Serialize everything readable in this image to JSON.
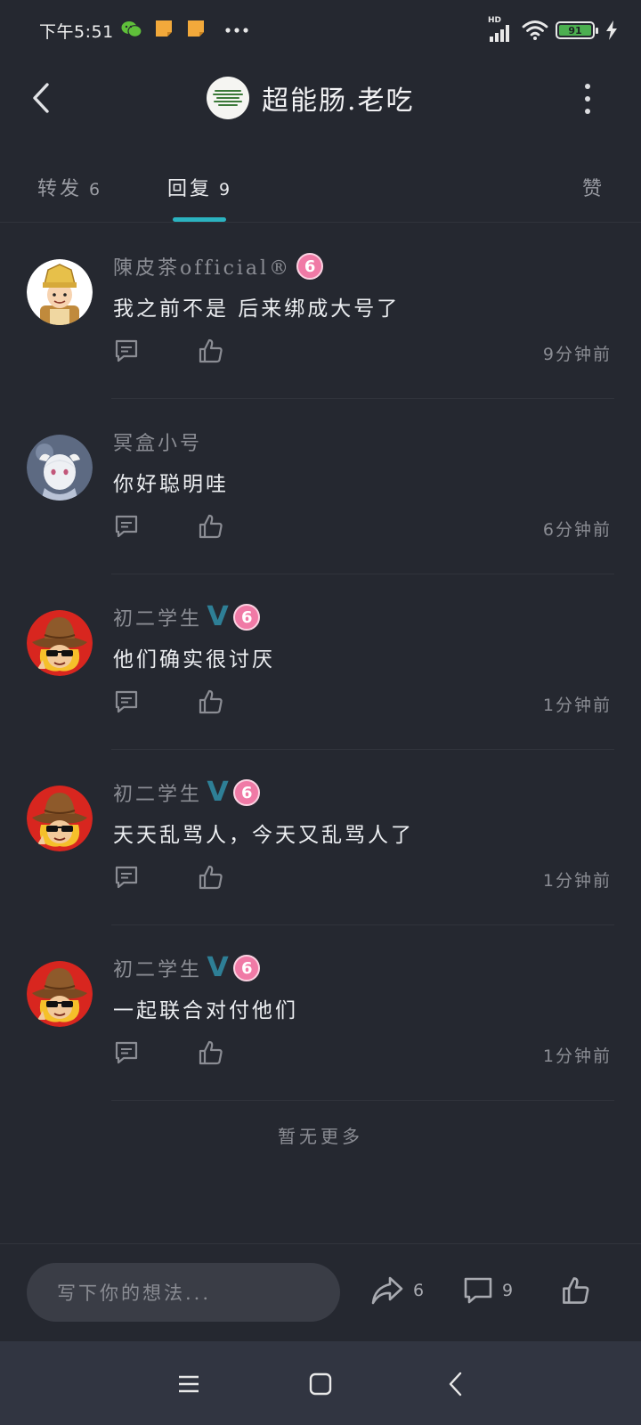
{
  "status_bar": {
    "time": "下午5:51",
    "network_label": "HD",
    "battery_level": "91",
    "icons": [
      "wechat-icon",
      "note-icon",
      "note-icon",
      "more-dots-icon",
      "signal-icon",
      "wifi-icon",
      "battery-icon",
      "charging-icon"
    ]
  },
  "header": {
    "title": "超能肠.老吃",
    "back_icon": "chevron-left-icon",
    "more_icon": "vertical-dots-icon"
  },
  "tabs": [
    {
      "label": "转发",
      "count": "6"
    },
    {
      "label": "回复",
      "count": "9",
      "active": true
    },
    {
      "label": "赞",
      "count": ""
    }
  ],
  "comments": [
    {
      "name": "陳皮茶official®",
      "vip": false,
      "badge": "6",
      "text": "我之前不是 后来绑成大号了",
      "time": "9分钟前",
      "avatar": "emperor-avatar"
    },
    {
      "name": "冥盒小号",
      "vip": false,
      "badge": "",
      "text": "你好聪明哇",
      "time": "6分钟前",
      "avatar": "anime-avatar"
    },
    {
      "name": "初二学生",
      "vip": true,
      "vip_mark": "V",
      "badge": "6",
      "text": "他们确实很讨厌",
      "time": "1分钟前",
      "avatar": "cowboy-avatar"
    },
    {
      "name": "初二学生",
      "vip": true,
      "vip_mark": "V",
      "badge": "6",
      "text": "天天乱骂人，今天又乱骂人了",
      "time": "1分钟前",
      "avatar": "cowboy-avatar"
    },
    {
      "name": "初二学生",
      "vip": true,
      "vip_mark": "V",
      "badge": "6",
      "text": "一起联合对付他们",
      "time": "1分钟前",
      "avatar": "cowboy-avatar"
    }
  ],
  "no_more_text": "暂无更多",
  "bottom_bar": {
    "input_placeholder": "写下你的想法...",
    "repost_count": "6",
    "comment_count": "9"
  },
  "colors": {
    "background": "#252830",
    "accent": "#2bb3c0",
    "vip": "#2e7f96",
    "badge": "#f07aa6",
    "navbar": "#313541"
  }
}
